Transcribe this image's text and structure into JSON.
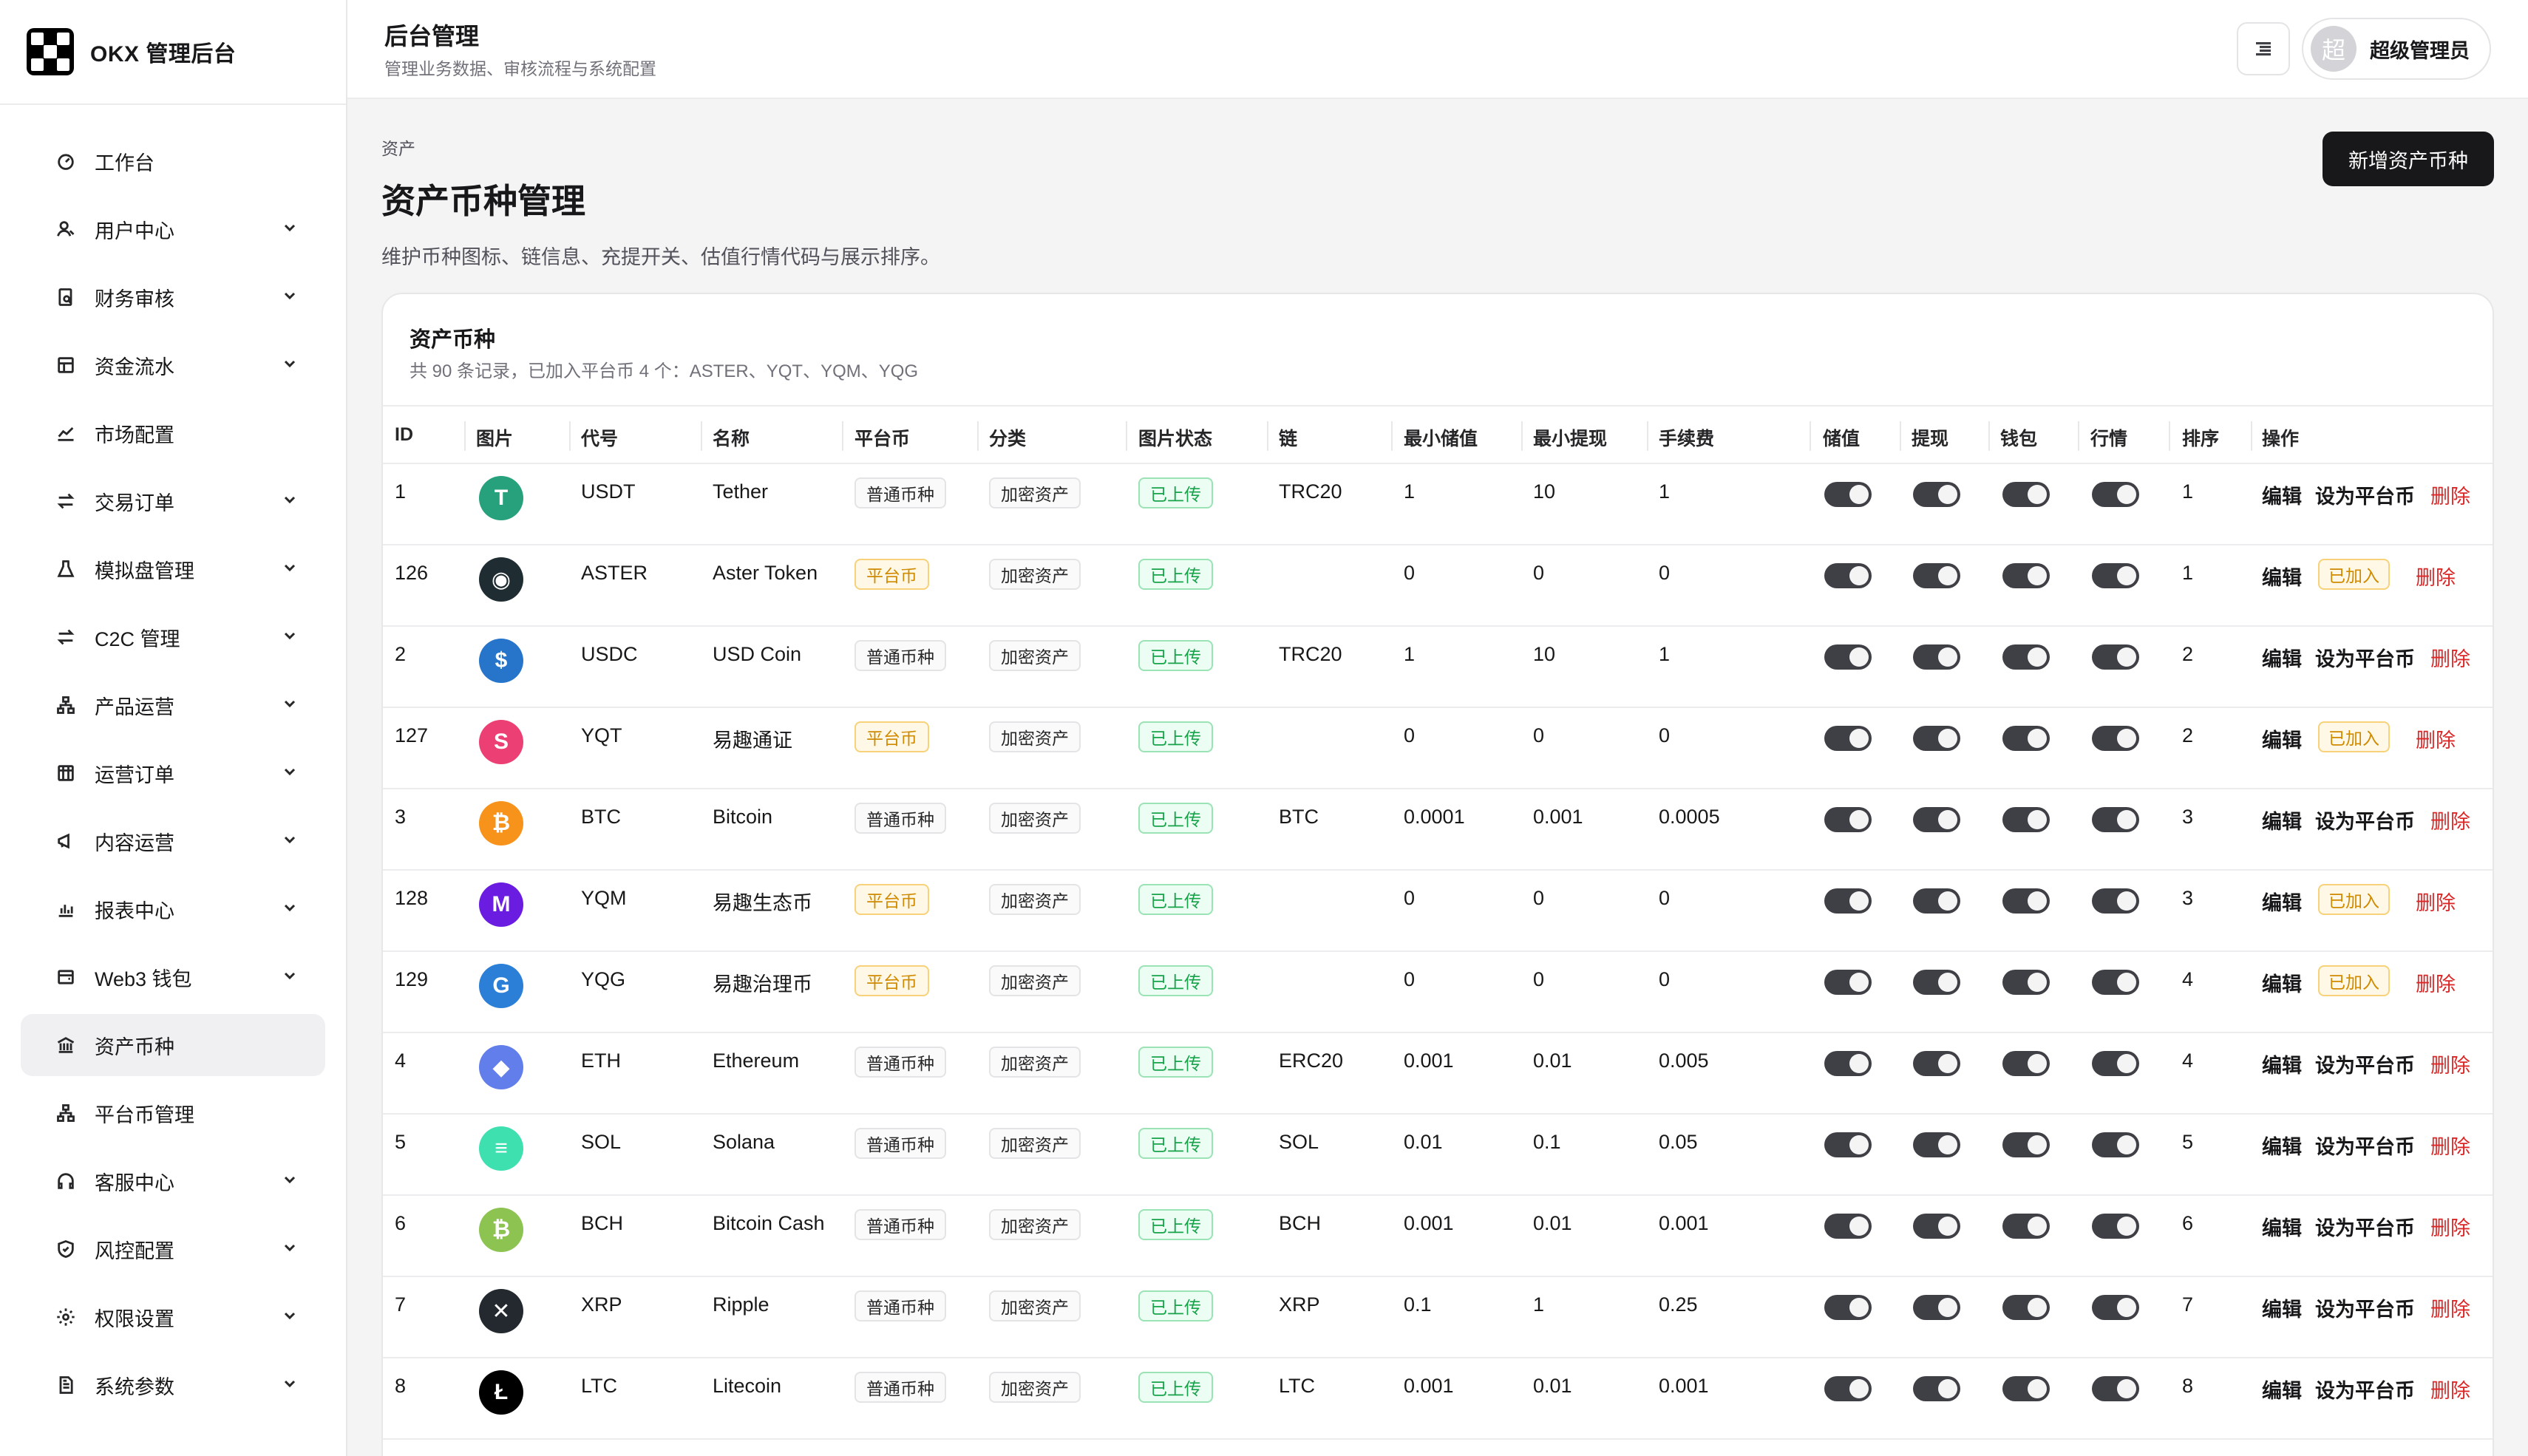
{
  "brand": {
    "title": "OKX 管理后台"
  },
  "nav": [
    {
      "label": "工作台",
      "icon": "dashboard-icon",
      "caret": false,
      "active": false
    },
    {
      "label": "用户中心",
      "icon": "users-icon",
      "caret": true,
      "active": false
    },
    {
      "label": "财务审核",
      "icon": "audit-icon",
      "caret": true,
      "active": false
    },
    {
      "label": "资金流水",
      "icon": "ledger-icon",
      "caret": true,
      "active": false
    },
    {
      "label": "市场配置",
      "icon": "chart-line-icon",
      "caret": false,
      "active": false
    },
    {
      "label": "交易订单",
      "icon": "exchange-icon",
      "caret": true,
      "active": false
    },
    {
      "label": "模拟盘管理",
      "icon": "flask-icon",
      "caret": true,
      "active": false
    },
    {
      "label": "C2C 管理",
      "icon": "exchange-icon",
      "caret": true,
      "active": false
    },
    {
      "label": "产品运营",
      "icon": "network-icon",
      "caret": true,
      "active": false
    },
    {
      "label": "运营订单",
      "icon": "calendar-icon",
      "caret": true,
      "active": false
    },
    {
      "label": "内容运营",
      "icon": "megaphone-icon",
      "caret": true,
      "active": false
    },
    {
      "label": "报表中心",
      "icon": "bar-chart-icon",
      "caret": true,
      "active": false
    },
    {
      "label": "Web3 钱包",
      "icon": "wallet-icon",
      "caret": true,
      "active": false
    },
    {
      "label": "资产币种",
      "icon": "bank-icon",
      "caret": false,
      "active": true
    },
    {
      "label": "平台币管理",
      "icon": "network-icon",
      "caret": false,
      "active": false
    },
    {
      "label": "客服中心",
      "icon": "headset-icon",
      "caret": true,
      "active": false
    },
    {
      "label": "风控配置",
      "icon": "shield-icon",
      "caret": true,
      "active": false
    },
    {
      "label": "权限设置",
      "icon": "gear-icon",
      "caret": true,
      "active": false
    },
    {
      "label": "系统参数",
      "icon": "document-icon",
      "caret": true,
      "active": false
    }
  ],
  "header": {
    "title": "后台管理",
    "subtitle": "管理业务数据、审核流程与系统配置",
    "user_avatar": "超",
    "user_name": "超级管理员"
  },
  "page": {
    "breadcrumb": "资产",
    "title": "资产币种管理",
    "description": "维护币种图标、链信息、充提开关、估值行情代码与展示排序。",
    "add_button": "新增资产币种"
  },
  "card": {
    "title": "资产币种",
    "summary": "共 90 条记录，已加入平台币 4 个：ASTER、YQT、YQM、YQG"
  },
  "columns": [
    "ID",
    "图片",
    "代号",
    "名称",
    "平台币",
    "分类",
    "图片状态",
    "链",
    "最小储值",
    "最小提现",
    "手续费",
    "储值",
    "提现",
    "钱包",
    "行情",
    "排序",
    "操作"
  ],
  "actions": {
    "edit": "编辑",
    "set_platform": "设为平台币",
    "joined": "已加入",
    "delete": "删除"
  },
  "rows": [
    {
      "id": "1",
      "symbol": "USDT",
      "name": "Tether",
      "platform": "普通币种",
      "is_platform": false,
      "category": "加密资产",
      "img_status": "已上传",
      "chain": "TRC20",
      "min_deposit": "1",
      "min_withdraw": "10",
      "fee": "1",
      "sort": "1",
      "icon_color": "#26a17b",
      "icon_glyph": "T"
    },
    {
      "id": "126",
      "symbol": "ASTER",
      "name": "Aster Token",
      "platform": "平台币",
      "is_platform": true,
      "category": "加密资产",
      "img_status": "已上传",
      "chain": "",
      "min_deposit": "0",
      "min_withdraw": "0",
      "fee": "0",
      "sort": "1",
      "icon_color": "#1f2d33",
      "icon_glyph": "◉"
    },
    {
      "id": "2",
      "symbol": "USDC",
      "name": "USD Coin",
      "platform": "普通币种",
      "is_platform": false,
      "category": "加密资产",
      "img_status": "已上传",
      "chain": "TRC20",
      "min_deposit": "1",
      "min_withdraw": "10",
      "fee": "1",
      "sort": "2",
      "icon_color": "#2775ca",
      "icon_glyph": "$"
    },
    {
      "id": "127",
      "symbol": "YQT",
      "name": "易趣通证",
      "platform": "平台币",
      "is_platform": true,
      "category": "加密资产",
      "img_status": "已上传",
      "chain": "",
      "min_deposit": "0",
      "min_withdraw": "0",
      "fee": "0",
      "sort": "2",
      "icon_color": "#ec3f74",
      "icon_glyph": "S"
    },
    {
      "id": "3",
      "symbol": "BTC",
      "name": "Bitcoin",
      "platform": "普通币种",
      "is_platform": false,
      "category": "加密资产",
      "img_status": "已上传",
      "chain": "BTC",
      "min_deposit": "0.0001",
      "min_withdraw": "0.001",
      "fee": "0.0005",
      "sort": "3",
      "icon_color": "#f7931a",
      "icon_glyph": "₿"
    },
    {
      "id": "128",
      "symbol": "YQM",
      "name": "易趣生态币",
      "platform": "平台币",
      "is_platform": true,
      "category": "加密资产",
      "img_status": "已上传",
      "chain": "",
      "min_deposit": "0",
      "min_withdraw": "0",
      "fee": "0",
      "sort": "3",
      "icon_color": "#6a1de0",
      "icon_glyph": "M"
    },
    {
      "id": "129",
      "symbol": "YQG",
      "name": "易趣治理币",
      "platform": "平台币",
      "is_platform": true,
      "category": "加密资产",
      "img_status": "已上传",
      "chain": "",
      "min_deposit": "0",
      "min_withdraw": "0",
      "fee": "0",
      "sort": "4",
      "icon_color": "#2b7fd6",
      "icon_glyph": "G"
    },
    {
      "id": "4",
      "symbol": "ETH",
      "name": "Ethereum",
      "platform": "普通币种",
      "is_platform": false,
      "category": "加密资产",
      "img_status": "已上传",
      "chain": "ERC20",
      "min_deposit": "0.001",
      "min_withdraw": "0.01",
      "fee": "0.005",
      "sort": "4",
      "icon_color": "#627eea",
      "icon_glyph": "◆"
    },
    {
      "id": "5",
      "symbol": "SOL",
      "name": "Solana",
      "platform": "普通币种",
      "is_platform": false,
      "category": "加密资产",
      "img_status": "已上传",
      "chain": "SOL",
      "min_deposit": "0.01",
      "min_withdraw": "0.1",
      "fee": "0.05",
      "sort": "5",
      "icon_color": "#3ee0b0",
      "icon_glyph": "≡"
    },
    {
      "id": "6",
      "symbol": "BCH",
      "name": "Bitcoin Cash",
      "platform": "普通币种",
      "is_platform": false,
      "category": "加密资产",
      "img_status": "已上传",
      "chain": "BCH",
      "min_deposit": "0.001",
      "min_withdraw": "0.01",
      "fee": "0.001",
      "sort": "6",
      "icon_color": "#8dc351",
      "icon_glyph": "₿"
    },
    {
      "id": "7",
      "symbol": "XRP",
      "name": "Ripple",
      "platform": "普通币种",
      "is_platform": false,
      "category": "加密资产",
      "img_status": "已上传",
      "chain": "XRP",
      "min_deposit": "0.1",
      "min_withdraw": "1",
      "fee": "0.25",
      "sort": "7",
      "icon_color": "#23292f",
      "icon_glyph": "✕"
    },
    {
      "id": "8",
      "symbol": "LTC",
      "name": "Litecoin",
      "platform": "普通币种",
      "is_platform": false,
      "category": "加密资产",
      "img_status": "已上传",
      "chain": "LTC",
      "min_deposit": "0.001",
      "min_withdraw": "0.01",
      "fee": "0.001",
      "sort": "8",
      "icon_color": "#000000",
      "icon_glyph": "Ł"
    }
  ]
}
